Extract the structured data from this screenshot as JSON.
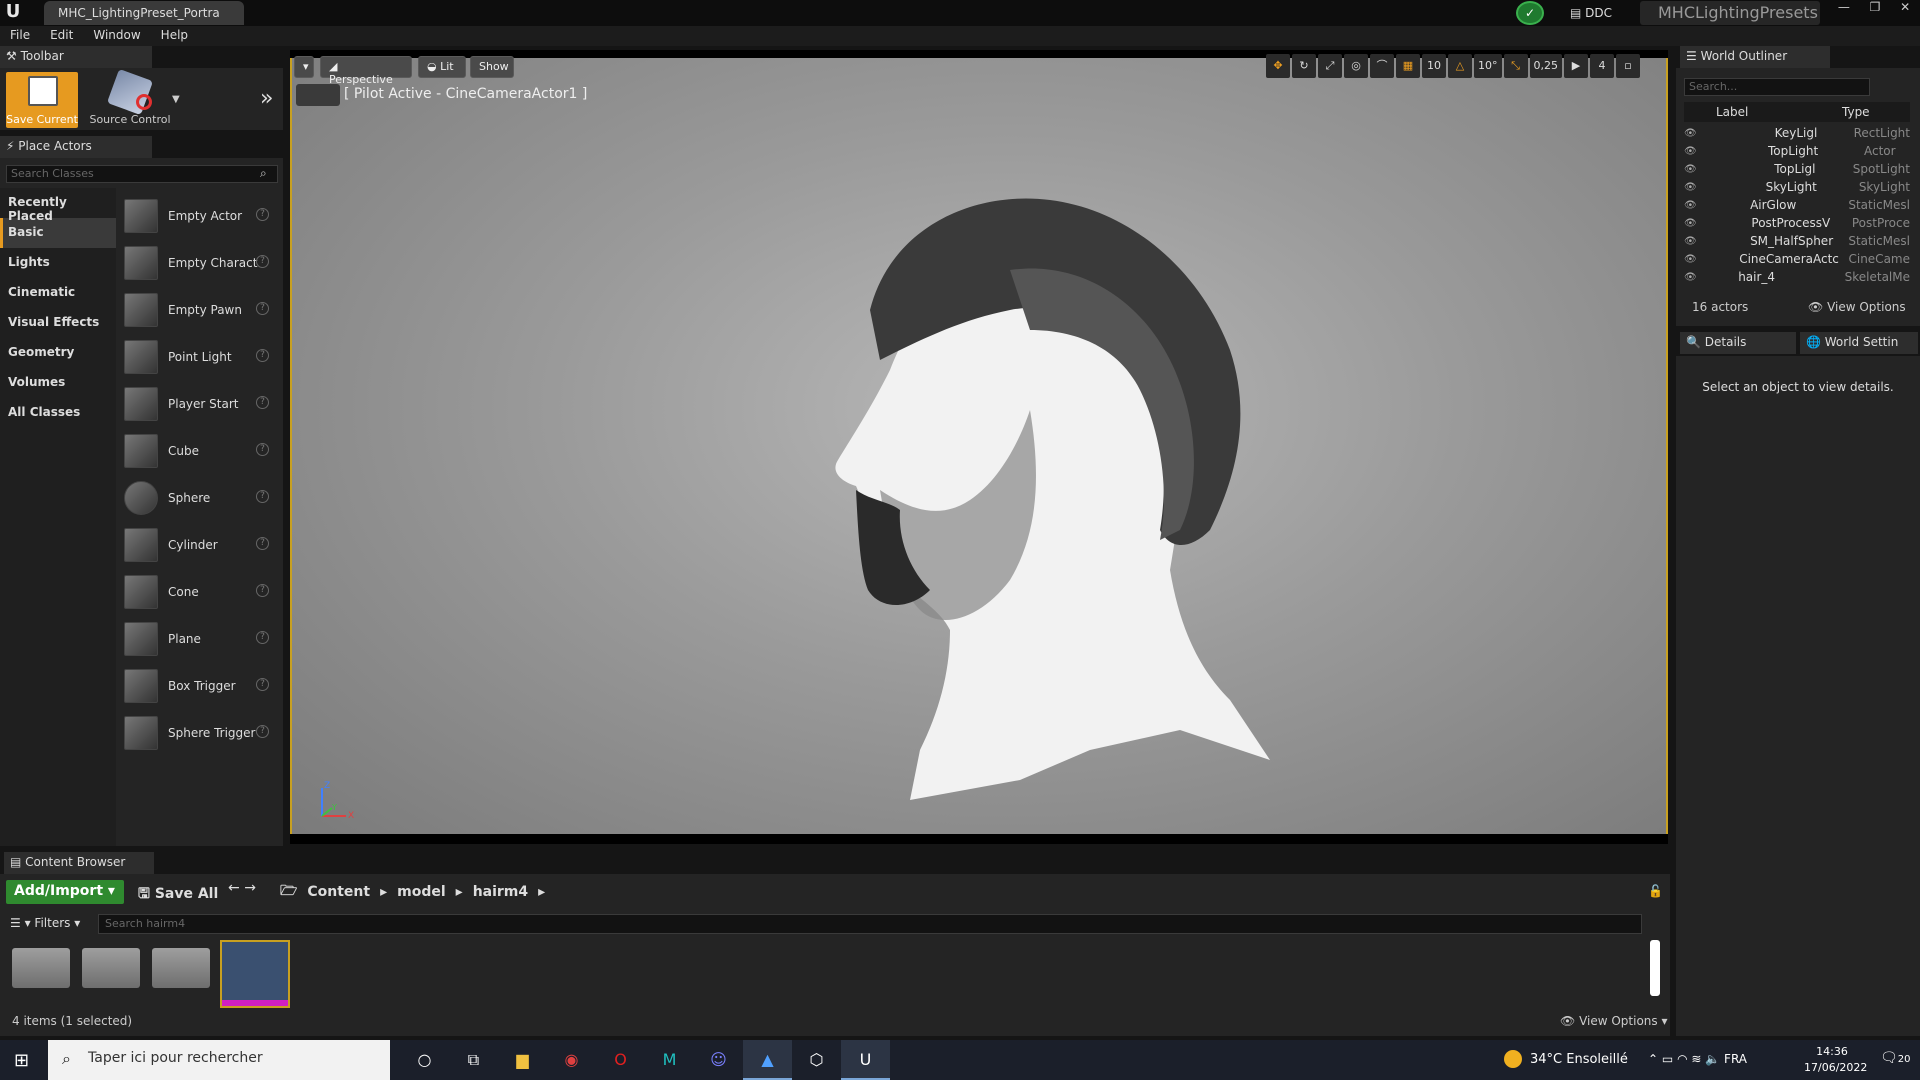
{
  "titlebar": {
    "tab_title": "MHC_LightingPreset_Portra",
    "ddc_label": "DDC",
    "project_name": "MHCLightingPresets"
  },
  "menu": [
    "File",
    "Edit",
    "Window",
    "Help"
  ],
  "toolbar": {
    "tab_label": "Toolbar",
    "save_label": "Save Current",
    "source_control_label": "Source Control"
  },
  "place_actors": {
    "tab_label": "Place Actors",
    "search_placeholder": "Search Classes",
    "categories": [
      "Recently Placed",
      "Basic",
      "Lights",
      "Cinematic",
      "Visual Effects",
      "Geometry",
      "Volumes",
      "All Classes"
    ],
    "active_category": "Basic",
    "actors": [
      "Empty Actor",
      "Empty Charact",
      "Empty Pawn",
      "Point Light",
      "Player Start",
      "Cube",
      "Sphere",
      "Cylinder",
      "Cone",
      "Plane",
      "Box Trigger",
      "Sphere Trigger"
    ]
  },
  "viewport": {
    "perspective_label": "Perspective",
    "lit_label": "Lit",
    "show_label": "Show",
    "pilot_text": "[ Pilot Active - CineCameraActor1 ]",
    "grid_snap": "10",
    "rotation_snap": "10°",
    "scale_snap": "0,25",
    "camera_speed": "4"
  },
  "outliner": {
    "tab_label": "World Outliner",
    "search_placeholder": "Search...",
    "col_label": "Label",
    "col_type": "Type",
    "rows": [
      {
        "label": "KeyLigl",
        "type": "RectLight",
        "indent": 3
      },
      {
        "label": "TopLight",
        "type": "Actor",
        "indent": 2
      },
      {
        "label": "TopLigl",
        "type": "SpotLight",
        "indent": 3
      },
      {
        "label": "SkyLight",
        "type": "SkyLight",
        "indent": 2
      },
      {
        "label": "AirGlow",
        "type": "StaticMesl",
        "indent": 1
      },
      {
        "label": "PostProcessV",
        "type": "PostProce",
        "indent": 1
      },
      {
        "label": "SM_HalfSpher",
        "type": "StaticMesl",
        "indent": 1
      },
      {
        "label": "CineCameraActc",
        "type": "CineCame",
        "indent": 0
      },
      {
        "label": "hair_4",
        "type": "SkeletalMe",
        "indent": 0
      }
    ],
    "actor_count": "16 actors",
    "view_options": "View Options"
  },
  "details": {
    "tab_label": "Details",
    "world_settings_label": "World Settin",
    "empty_message": "Select an object to view details."
  },
  "content_browser": {
    "tab_label": "Content Browser",
    "add_import_label": "Add/Import",
    "save_all_label": "Save All",
    "breadcrumb": [
      "Content",
      "model",
      "hairm4"
    ],
    "filters_label": "Filters",
    "search_placeholder": "Search hairm4",
    "items_count": "4 items (1 selected)",
    "view_options": "View Options"
  },
  "taskbar": {
    "search_placeholder": "Taper ici pour rechercher",
    "weather": "34°C  Ensoleillé",
    "language": "FRA",
    "time": "14:36",
    "date": "17/06/2022",
    "notifications": "20"
  },
  "colors": {
    "accent": "#e69a20",
    "viewport_border": "#c8a020",
    "add_import_green": "#2f8a2f"
  }
}
